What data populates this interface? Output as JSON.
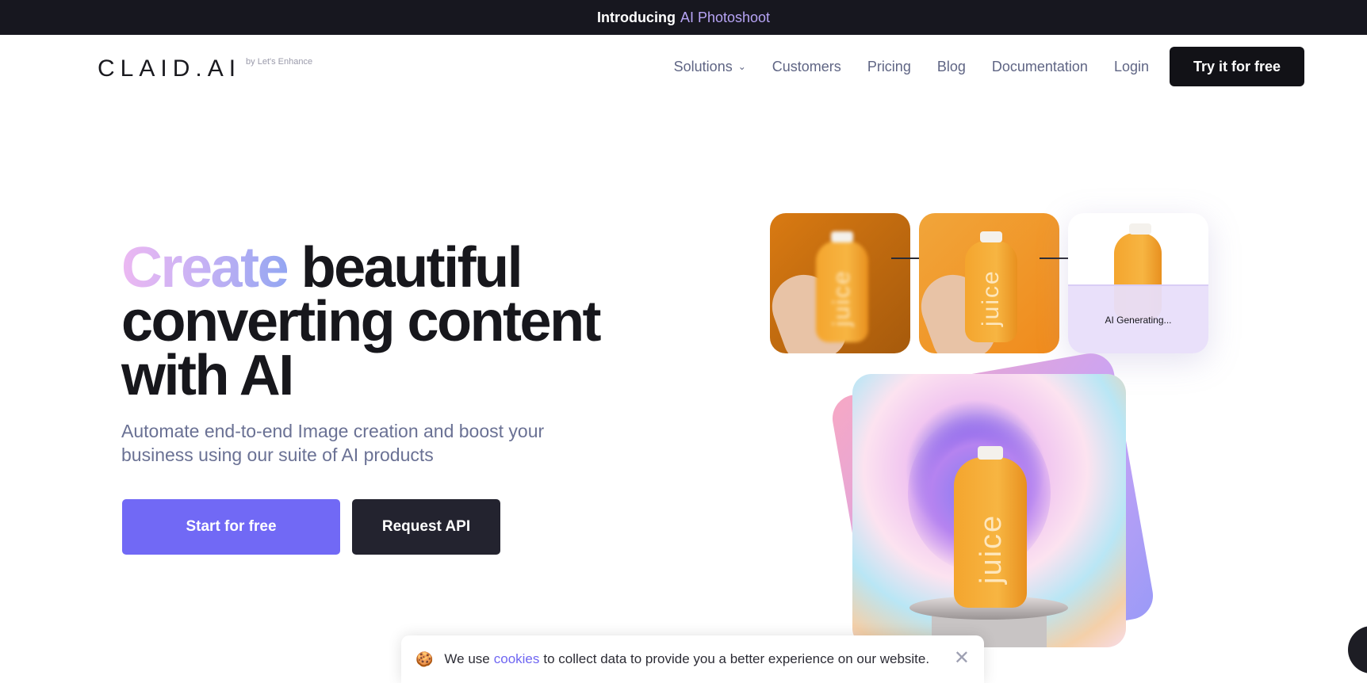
{
  "announcement": {
    "lead": "Introducing",
    "link": "AI Photoshoot"
  },
  "logo": {
    "mark": "CLAID.AI",
    "by": "by Let's Enhance"
  },
  "nav": {
    "items": [
      "Solutions",
      "Customers",
      "Pricing",
      "Blog",
      "Documentation",
      "Login"
    ],
    "cta": "Try it for free"
  },
  "hero": {
    "title_highlight": "Create",
    "title_rest": " beautiful converting content with AI",
    "subtitle": "Automate end-to-end Image creation and boost your business using our suite of AI products",
    "primary_button": "Start for free",
    "secondary_button": "Request API"
  },
  "showcase": {
    "bottle_label": "juice",
    "generating_text": "AI Generating..."
  },
  "cookie_banner": {
    "emoji": "🍪",
    "before": "We use",
    "link": "cookies",
    "after": "to collect data to provide you a better experience on our website.",
    "close": "✕"
  },
  "colors": {
    "accent": "#7169f5",
    "dark": "#17171f",
    "nav_text": "#5f6584"
  }
}
